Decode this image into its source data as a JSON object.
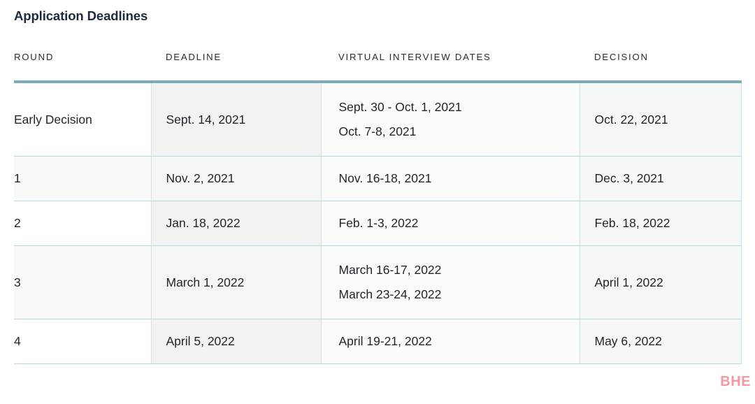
{
  "header": {
    "title": "Application Deadlines"
  },
  "theme": {
    "title_color": "#1d2b3a",
    "accent_rule_color": "#79acb7",
    "cell_border_color": "#cfe4e8",
    "text_color": "#21262c",
    "watermark_color": "#f2949f"
  },
  "table": {
    "name": "application-deadlines-table",
    "columns": [
      {
        "key": "round",
        "label": "ROUND"
      },
      {
        "key": "deadline",
        "label": "DEADLINE"
      },
      {
        "key": "interview",
        "label": "VIRTUAL INTERVIEW DATES"
      },
      {
        "key": "decision",
        "label": "DECISION"
      }
    ],
    "rows": [
      {
        "round": "Early Decision",
        "deadline": "Sept. 14, 2021",
        "interview_lines": [
          "Sept. 30 - Oct. 1, 2021",
          "Oct. 7-8, 2021"
        ],
        "decision": "Oct. 22, 2021"
      },
      {
        "round": "1",
        "deadline": "Nov. 2, 2021",
        "interview_lines": [
          "Nov. 16-18, 2021"
        ],
        "decision": "Dec. 3, 2021"
      },
      {
        "round": "2",
        "deadline": "Jan. 18, 2022",
        "interview_lines": [
          "Feb. 1-3, 2022"
        ],
        "decision": "Feb. 18, 2022"
      },
      {
        "round": "3",
        "deadline": "March 1, 2022",
        "interview_lines": [
          "March 16-17, 2022",
          "March 23-24, 2022"
        ],
        "decision": "April 1, 2022"
      },
      {
        "round": "4",
        "deadline": "April 5, 2022",
        "interview_lines": [
          "April 19-21, 2022"
        ],
        "decision": "May 6, 2022"
      }
    ]
  },
  "watermark": {
    "text": "BHE"
  }
}
